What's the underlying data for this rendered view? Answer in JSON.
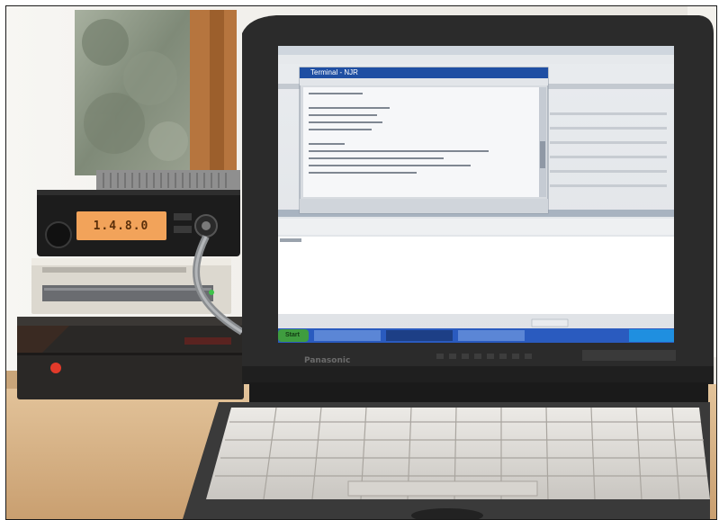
{
  "scene": {
    "description_alt": "Amateur radio station setup with a laptop",
    "transceiver": {
      "display_text": "1.4.8.0"
    },
    "laptop": {
      "brand": "Panasonic"
    },
    "screen": {
      "front_window_title": "Terminal - NJR",
      "back_window_title": "",
      "taskbar_start": "Start",
      "taskbar_items": [
        "",
        "",
        ""
      ]
    }
  },
  "colors": {
    "lcd": "#f2a35a",
    "wall": "#eeebe5",
    "desk": "#d7b489",
    "laptop_body": "#2b2b2b",
    "screen_bg": "#dfe3e7",
    "title_bar": "#1f4fa3",
    "taskbar": "#2a5bbf",
    "power_led": "#e23a2a"
  }
}
